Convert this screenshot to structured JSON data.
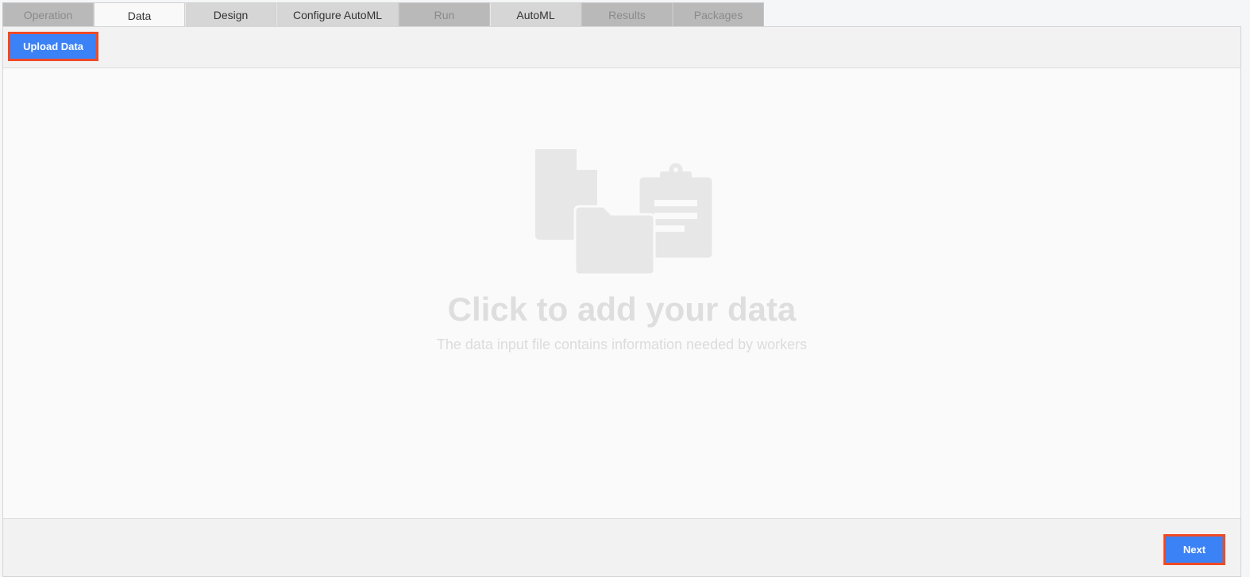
{
  "tabs": [
    {
      "label": "Operation",
      "state": "disabled"
    },
    {
      "label": "Data",
      "state": "active"
    },
    {
      "label": "Design",
      "state": "enabled"
    },
    {
      "label": "Configure AutoML",
      "state": "enabled"
    },
    {
      "label": "Run",
      "state": "disabled"
    },
    {
      "label": "AutoML",
      "state": "enabled"
    },
    {
      "label": "Results",
      "state": "disabled"
    },
    {
      "label": "Packages",
      "state": "disabled"
    }
  ],
  "toolbar": {
    "upload_label": "Upload Data"
  },
  "dropzone": {
    "icon": "file-folder-clipboard-icon",
    "title": "Click to add your data",
    "subtitle": "The data input file contains information needed by workers"
  },
  "footer": {
    "next_label": "Next"
  },
  "colors": {
    "accent": "#3b82f6",
    "highlight": "#f04a25"
  }
}
